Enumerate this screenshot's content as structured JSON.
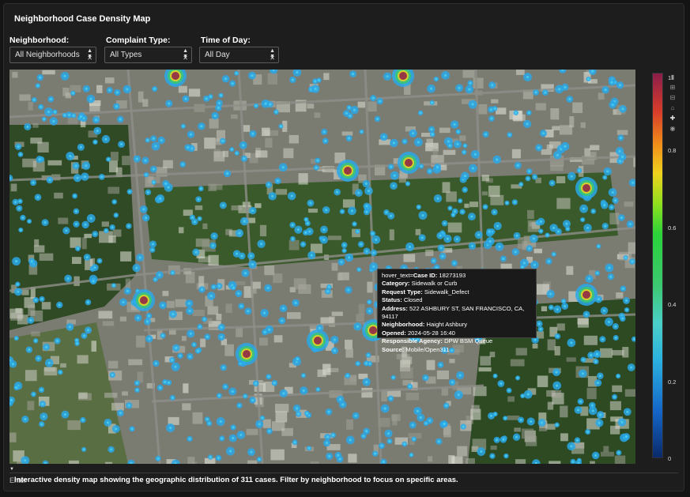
{
  "page": {
    "title": "Neighborhood Case Density Map",
    "caption": "Interactive density map showing the geographic distribution of 311 cases. Filter by neighborhood to focus on specific areas.",
    "caption_prefix_ghost": "Enter"
  },
  "filters": {
    "neighborhood": {
      "label": "Neighborhood:",
      "value": "All Neighborhoods"
    },
    "complaint_type": {
      "label": "Complaint Type:",
      "value": "All Types"
    },
    "time_of_day": {
      "label": "Time of Day:",
      "value": "All Day"
    }
  },
  "tooltip": {
    "header": "hover_text=",
    "case_id_label": "Case ID:",
    "case_id": "18273193",
    "category_label": "Category:",
    "category": "Sidewalk or Curb",
    "request_type_label": "Request Type:",
    "request_type": "Sidewalk_Defect",
    "status_label": "Status:",
    "status": "Closed",
    "address_label": "Address:",
    "address": "522 ASHBURY ST, SAN FRANCISCO, CA, 94117",
    "neighborhood_label": "Neighborhood:",
    "neighborhood": "Haight Ashbury",
    "opened_label": "Opened:",
    "opened": "2024-05-28 16:40",
    "agency_label": "Responsible Agency:",
    "agency": "DPW BSM Queue",
    "source_label": "Source:",
    "source": "Mobile/Open311"
  },
  "colorbar": {
    "ticks": [
      "1",
      "0.8",
      "0.6",
      "0.4",
      "0.2",
      "0"
    ],
    "colors": [
      "#0a2a6a",
      "#1466c8",
      "#2ab0e0",
      "#3cc870",
      "#2ad23a",
      "#f0d21e",
      "#f08a1a",
      "#d83c2a",
      "#8a1e4a"
    ]
  },
  "modebar": {
    "icons": [
      "bar-chart-icon",
      "zoom-in-icon",
      "zoom-out-icon",
      "home-icon",
      "pan-icon",
      "camera-icon"
    ]
  }
}
